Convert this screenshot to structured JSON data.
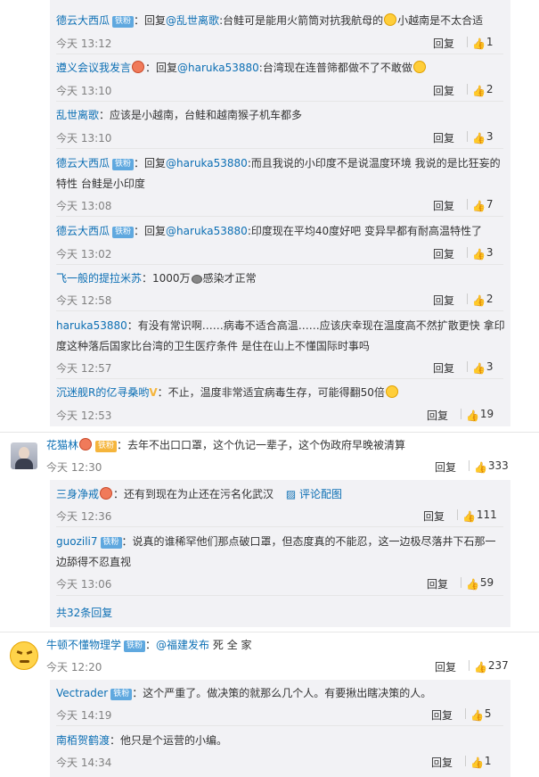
{
  "labels": {
    "reply": "回复",
    "like_icon": "thumb-up-icon"
  },
  "thread1": [
    {
      "user": "德云大西瓜",
      "badge": "铁粉",
      "prefix": "：回复",
      "mention": "@乱世离歌",
      "text": ":台鲑可是能用火箭筒对抗我航母的",
      "text2": "小越南是不太合适",
      "time": "今天 13:12",
      "likes": "1"
    },
    {
      "user": "遵义会议我发言",
      "badge": "",
      "prefix": "：回复",
      "mention": "@haruka53880",
      "text": ":台湾现在连普筛都做不了不敢做",
      "text2": "",
      "time": "今天 13:10",
      "likes": "2"
    },
    {
      "user": "乱世离歌",
      "badge": "",
      "prefix": "：应该是小越南，台鲑和越南猴子机车都多",
      "mention": "",
      "text": "",
      "text2": "",
      "time": "今天 13:10",
      "likes": "3"
    },
    {
      "user": "德云大西瓜",
      "badge": "铁粉",
      "prefix": "：回复",
      "mention": "@haruka53880",
      "text": ":而且我说的小印度不是说温度环境 我说的是比狂妄的",
      "text2": "特性 台鲑是小印度",
      "time": "今天 13:08",
      "likes": "7"
    },
    {
      "user": "德云大西瓜",
      "badge": "铁粉",
      "prefix": "：回复",
      "mention": "@haruka53880",
      "text": ":印度现在平均40度好吧 变异早都有耐高温特性了",
      "text2": "",
      "time": "今天 13:02",
      "likes": "3"
    },
    {
      "user": "飞一般的提拉米苏",
      "badge": "",
      "prefix": "：1000万",
      "mention": "",
      "text": "感染才正常",
      "text2": "",
      "time": "今天 12:58",
      "likes": "2"
    },
    {
      "user": "haruka53880",
      "badge": "",
      "prefix": "：有没有常识啊……病毒不适合高温……应该庆幸现在温度高不然扩散更快 拿印",
      "mention": "",
      "text": "",
      "text2": "度这种落后国家比台湾的卫生医疗条件 是住在山上不懂国际时事吗",
      "time": "今天 12:57",
      "likes": "3"
    },
    {
      "user": "沉迷舰R的亿寻桑哟",
      "badge": "",
      "prefix": "：不止，温度非常适宜病毒生存，可能得翻50倍",
      "mention": "",
      "text": "",
      "text2": "",
      "time": "今天 12:53",
      "likes": "19"
    }
  ],
  "main2": {
    "user": "花猫林",
    "badge": "铁粉",
    "text": "：去年不出口口罩，这个仇记一辈子，这个伪政府早晚被清算",
    "time": "今天 12:30",
    "likes": "333"
  },
  "main2_replies": [
    {
      "user": "三身净戒",
      "badge": "",
      "text": "：还有到现在为止还在污名化武汉",
      "pic": "评论配图",
      "time": "今天 12:36",
      "likes": "111"
    },
    {
      "user": "guozili7",
      "badge": "铁粉",
      "text": "：说真的谁稀罕他们那点破口罩，但态度真的不能忍，这一边极尽落井下石那一",
      "text2": "边舔得不忍直视",
      "time": "今天 13:06",
      "likes": "59"
    }
  ],
  "main2_more": "共32条回复",
  "main3": {
    "user": "牛顿不懂物理学",
    "badge": "铁粉",
    "mention": "@福建发布",
    "text": " 死 全 家",
    "time": "今天 12:20",
    "likes": "237"
  },
  "main3_replies": [
    {
      "user": "Vectrader",
      "badge": "铁粉",
      "text": "：这个严重了。做决策的就那么几个人。有要揪出瞎决策的人。",
      "time": "今天 14:19",
      "likes": "5"
    },
    {
      "user": "南栢贺鹤渡",
      "badge": "",
      "text": "：他只是个运营的小编。",
      "time": "今天 14:34",
      "likes": "1"
    }
  ]
}
